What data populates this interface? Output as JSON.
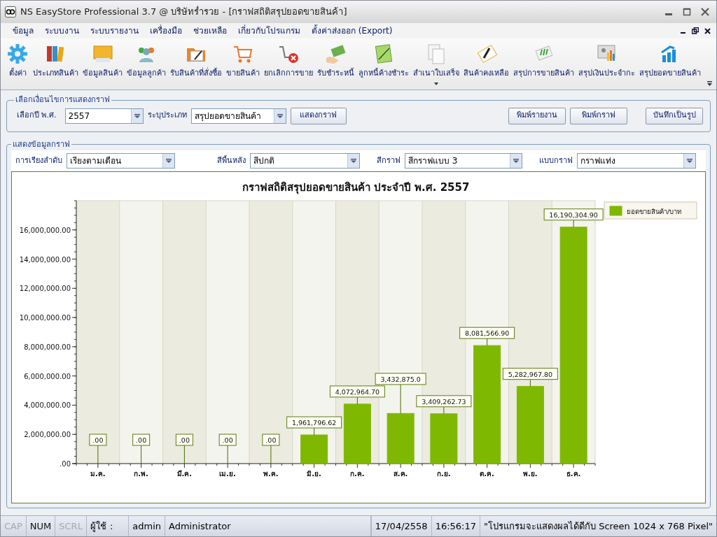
{
  "window": {
    "title": "NS EasyStore Professional 3.7 @ บริษัทร่ำรวย - [กราฟสถิติสรุปยอดขายสินค้า]"
  },
  "menu": [
    "ข้อมูล",
    "ระบบงาน",
    "ระบบรายงาน",
    "เครื่องมือ",
    "ช่วยเหลือ",
    "เกี่ยวกับโปรแกรม",
    "ตั้งค่าส่งออก (Export)"
  ],
  "toolbar": [
    {
      "label": "ตั้งค่า",
      "dropdown": false
    },
    {
      "label": "ประเภทสินค้า",
      "dropdown": false
    },
    {
      "label": "ข้อมูลสินค้า",
      "dropdown": false
    },
    {
      "label": "ข้อมูลลูกค้า",
      "dropdown": false
    },
    {
      "label": "รับสินค้าที่สั่งซื้อ",
      "dropdown": false
    },
    {
      "label": "ขายสินค้า",
      "dropdown": false
    },
    {
      "label": "ยกเลิกการขาย",
      "dropdown": false
    },
    {
      "label": "รับชำระหนี้",
      "dropdown": false
    },
    {
      "label": "ลูกหนี้ค้างชำระ",
      "dropdown": false
    },
    {
      "label": "สำเนาใบเสร็จ",
      "dropdown": true
    },
    {
      "label": "สินค้าคงเหลือ",
      "dropdown": false
    },
    {
      "label": "สรุปการขายสินค้า",
      "dropdown": false
    },
    {
      "label": "สรุปเงินประจำกะ",
      "dropdown": false
    },
    {
      "label": "สรุปยอดขายสินค้า",
      "dropdown": false
    }
  ],
  "conditions": {
    "title": "เลือกเงื่อนไขการแสดงกราฟ",
    "year_label": "เลือกปี พ.ศ.",
    "year": "2557",
    "type_label": "ระบุประเภท",
    "type": "สรุปยอดขายสินค้า",
    "buttons": [
      "แสดงกราฟ",
      "พิมพ์รายงาน",
      "พิมพ์กราฟ",
      "บันทึกเป็นรูป"
    ]
  },
  "display": {
    "title": "แสดงข้อมูลกราฟ",
    "options": [
      {
        "label": "การเรียงลำดับ",
        "value": "เรียงตามเดือน"
      },
      {
        "label": "สีพื้นหลัง",
        "value": "สีปกติ"
      },
      {
        "label": "สีกราฟ",
        "value": "สีกราฟแบบ 3"
      },
      {
        "label": "แบบกราฟ",
        "value": "กราฟแท่ง"
      }
    ]
  },
  "chart_data": {
    "type": "bar",
    "title": "กราฟสถิติสรุปยอดขายสินค้า  ประจำปี  พ.ศ. 2557",
    "categories": [
      "ม.ค.",
      "ก.พ.",
      "มี.ค.",
      "เม.ย.",
      "พ.ค.",
      "มิ.ย.",
      "ก.ค.",
      "ส.ค.",
      "ก.ย.",
      "ต.ค.",
      "พ.ย.",
      "ธ.ค."
    ],
    "series": [
      {
        "name": "ยอดขายสินค้า/บาท",
        "color": "#7fb800",
        "values": [
          0,
          0,
          0,
          0,
          0,
          1961796.62,
          4072964.7,
          3432875.0,
          3409262.73,
          8081566.9,
          5282967.8,
          16190304.9
        ]
      }
    ],
    "value_labels": [
      ".00",
      ".00",
      ".00",
      ".00",
      ".00",
      "1,961,796.62",
      "4,072,964.70",
      "3,432,875.0",
      "3,409,262.73",
      "8,081,566.90",
      "5,282,967.80",
      "16,190,304.90"
    ],
    "ylim": [
      0,
      18000000
    ],
    "yticks": [
      {
        "value": 0,
        "label": ".00"
      },
      {
        "value": 2000000,
        "label": "2,000,000.00"
      },
      {
        "value": 4000000,
        "label": "4,000,000.00"
      },
      {
        "value": 6000000,
        "label": "6,000,000.00"
      },
      {
        "value": 8000000,
        "label": "8,000,000.00"
      },
      {
        "value": 10000000,
        "label": "10,000,000.00"
      },
      {
        "value": 12000000,
        "label": "12,000,000.00"
      },
      {
        "value": 14000000,
        "label": "14,000,000.00"
      },
      {
        "value": 16000000,
        "label": "16,000,000.00"
      }
    ]
  },
  "status_bar": {
    "keys": [
      {
        "label": "CAP",
        "on": false
      },
      {
        "label": "NUM",
        "on": true
      },
      {
        "label": "SCRL",
        "on": false
      }
    ],
    "user_label": "ผู้ใช้",
    "separator": ":",
    "user": "admin",
    "role": "Administrator",
    "date": "17/04/2558",
    "time": "16:56:17",
    "message": "\"โปรแกรมจะแสดงผลได้ดีกับ   Screen 1024 x 768 Pixel\""
  }
}
